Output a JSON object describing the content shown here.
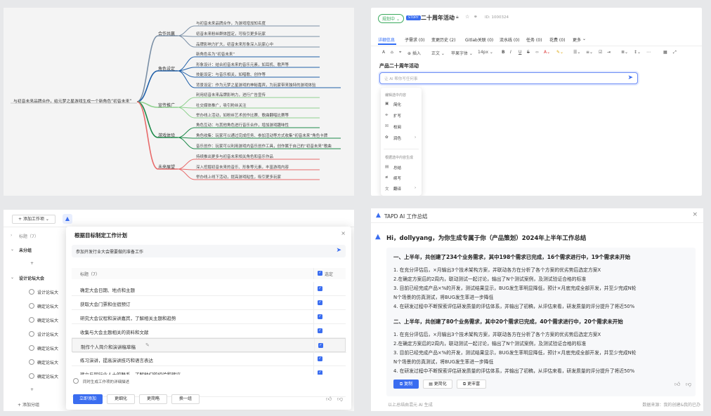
{
  "mindmap": {
    "root": "与初音未来品牌合作，给元梦之星游戏生成一个新角色“初音未来”",
    "branches": [
      {
        "label": "合作共赢",
        "color": "#7a8fa6",
        "items": [
          "与初音未来品牌合作，为游戏增加知名度",
          "初音未来粉丝群体固定，可吸引更多玩家",
          "品牌影响力扩大，初音未来形象深入玩家心中"
        ]
      },
      {
        "label": "角色设定",
        "color": "#1f5fa8",
        "items": [
          "新角色名为“初音未来”",
          "形象设计：结合初音未来的音乐元素，如耳机、歌声等",
          "技能设定：与音乐相关，如唱歌、创作等",
          "背景设定：作为元梦之星游戏的神秘嘉宾，为玩家带来独特的游戏体验"
        ]
      },
      {
        "label": "宣传推广",
        "color": "#8fd18f",
        "items": [
          "利用初音未来品牌影响力，进行广告宣传",
          "社交媒体推广，吸引粉丝关注",
          "举办线上活动，如粉丝艺术创作比赛、歌曲翻唱比赛等"
        ]
      },
      {
        "label": "游戏体验",
        "color": "#1e8a4a",
        "items": [
          "角色互动：与其他角色进行音乐合作，增加游戏趣味性",
          "角色收集：玩家可以通过完成任务、参加活动等方式收集“初音未来”角色卡牌",
          "音乐创作：玩家可以利用游戏内音乐创作工具，创作属于自己的“初音未来”歌曲"
        ]
      },
      {
        "label": "未来展望",
        "color": "#e86b6b",
        "items": [
          "持续推出更多与初音未来相关角色和音乐作品",
          "深入挖掘初音未来的音乐、形象等元素，丰富游戏内容",
          "举办线上线下活动，提高游戏粘性，吸引更多玩家"
        ]
      }
    ]
  },
  "story": {
    "status": "规划中",
    "type_tag": "STORY",
    "title": "二十周年活动",
    "id_text": "ID: 1000324",
    "tabs": [
      "详细信息",
      "子需求 (0)",
      "变更历史 (2)",
      "Gitlab关联 (0)",
      "流水线 (0)",
      "任务 (0)",
      "花费 (0)",
      "更多"
    ],
    "toolbar": [
      "插入",
      "正文",
      "苹果字体",
      "14px"
    ],
    "heading": "产品二十周年活动",
    "ai_placeholder": "让 AI 帮你写任何事",
    "menu": {
      "section1": "编辑选中内容",
      "items1": [
        {
          "icon": "polish-icon",
          "label": "简化"
        },
        {
          "icon": "expand-icon",
          "label": "扩写"
        },
        {
          "icon": "proofread-icon",
          "label": "校阅"
        },
        {
          "icon": "tone-icon",
          "label": "润色"
        }
      ],
      "section2": "根据选中内容生成",
      "items2": [
        {
          "icon": "summary-icon",
          "label": "总结"
        },
        {
          "icon": "continue-icon",
          "label": "续写"
        },
        {
          "icon": "translate-icon",
          "label": "翻译"
        }
      ]
    }
  },
  "plan": {
    "add_item": "添加工作项",
    "sidebar": [
      {
        "label": "标题（7）",
        "kind": "header"
      },
      {
        "label": "未分组",
        "kind": "group"
      },
      {
        "label": "+",
        "kind": "add"
      },
      {
        "label": "设计论坛大会",
        "kind": "group"
      },
      {
        "label": "设计论坛大",
        "kind": "item"
      },
      {
        "label": "确定论坛大",
        "kind": "item"
      },
      {
        "label": "确定论坛大",
        "kind": "item"
      },
      {
        "label": "设计论坛大",
        "kind": "item"
      },
      {
        "label": "确定论坛大",
        "kind": "item"
      },
      {
        "label": "确定论坛大",
        "kind": "item"
      },
      {
        "label": "确定论坛大",
        "kind": "item"
      },
      {
        "label": "+",
        "kind": "add"
      }
    ],
    "add_group": "添加分组",
    "dialog_title": "根据目标制定工作计划",
    "goal_input": "参加开发行业大会需要做的准备工作",
    "col_title": "标题（7）",
    "col_select": "选定",
    "tasks": [
      "确定大会日期、地点和主题",
      "获取大会门票和住宿预订",
      "研究大会议程和演讲嘉宾，了解相关主题和趋势",
      "收集与大会主题相关的资料和文献",
      "制作个人简介和演讲稿草稿",
      "练习演讲，提高演讲技巧和语言表达",
      "建立与同行业人士的联系，了解他们的经验和建议"
    ],
    "desc_option": "同时生成工作项的详细描述",
    "buttons": [
      "立即添加",
      "更细化",
      "更简略",
      "换一组"
    ]
  },
  "summary": {
    "app_title": "TAPD AI 工作总结",
    "greeting": "Hi，dollyyang，为你生成专属于你（产品策划）2024年上半年工作总结",
    "sections": [
      {
        "title": "一、上半年，共创建了234个业务需求，其中198个需求已完成，16个需求进行中，19个需求未开始",
        "lines": [
          "1. 在充分评估后，×月输出3个技术架构方案，并联动各方在分析了各个方案的优劣势后选定方案X",
          "2.在确定方案后的2周内，联动测试一起讨论，输出了N个测试案例，及测试验证合格的标准",
          "3. 目前已经完成产品×%的开发，测试结果显示，BUG发生率明显降低，预计×月底完成全部开发，并至少完成N轮",
          "N个场景的仿真测试，将BUG发生率进一步降低",
          "4. 在研发过程中不断探索评估研发质量的评估体系，并输出了初稿，从评估来看，研发质量的评分提升了将近50%"
        ]
      },
      {
        "title": "二、上半年，共创建了80个业务需求，其中20个需求已完成，40个需求进行中，20个需求未开始",
        "lines": [
          "1. 在充分评估后，×月输出3个技术架构方案，并联动各方在分析了各个方案的优劣势后选定方案X",
          "2.在确定方案后的2周内，联动测试一起讨论，输出了N个测试案例，及测试验证合格的标准",
          "3. 目前已经完成产品×%的开发，测试结果显示，BUG发生率明显降低，预计×月底完成全部开发，并至少完成N轮",
          "N个场景的仿真测试，将BUG发生率进一步降低",
          "4. 在研发过程中不断探索评估研发质量的评估体系，并输出了初稿，从评估来看，研发质量的评分提升了将近50%"
        ]
      }
    ],
    "actions": [
      "复制",
      "更简化",
      "更丰富"
    ],
    "footer_left": "以上总结由混元 AI 生成",
    "footer_right": "数据来源：我的创建&我的已办"
  },
  "colors": {
    "accent": "#3a6df0",
    "green": "#3aaa5d"
  }
}
